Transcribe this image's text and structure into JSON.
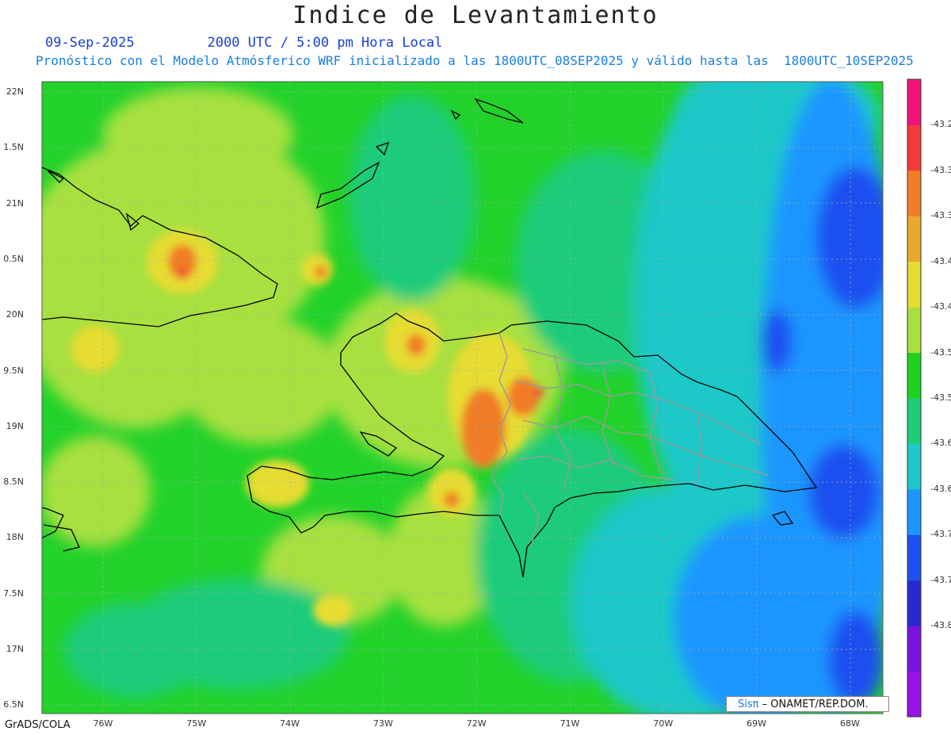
{
  "title": "Indice de Levantamiento",
  "subtitle": {
    "date": "09-Sep-2025",
    "time": "2000 UTC / 5:00 pm Hora Local",
    "forecast": "Pronóstico con el Modelo Atmósferico WRF inicializado a las 1800UTC_08SEP2025 y válido hasta las  1800UTC_10SEP2025"
  },
  "lat_labels": [
    "22N",
    "1.5N",
    "21N",
    "0.5N",
    "20N",
    "9.5N",
    "19N",
    "8.5N",
    "18N",
    "7.5N",
    "17N",
    "6.5N"
  ],
  "lon_labels": [
    "76W",
    "75W",
    "74W",
    "73W",
    "72W",
    "71W",
    "70W",
    "69W",
    "68W"
  ],
  "colorbar": {
    "labels": [
      "-43.2",
      "-43.3",
      "-43.3",
      "-43.4",
      "-43.4",
      "-43.5",
      "-43.5",
      "-43.6",
      "-43.6",
      "-43.7",
      "-43.7",
      "-43.8"
    ],
    "colors": [
      "#f01478",
      "#f23a3a",
      "#f07d28",
      "#e6ab2d",
      "#e6dc32",
      "#a8e040",
      "#1ed21e",
      "#1ecc7a",
      "#1ec8c8",
      "#1e96ff",
      "#1e50f0",
      "#2828d2",
      "#7814dc",
      "#9614e6"
    ]
  },
  "credit": "GrADS/COLA",
  "logo": {
    "brand": "Sisπ",
    "org": "– ONAMET/REP.DOM."
  }
}
